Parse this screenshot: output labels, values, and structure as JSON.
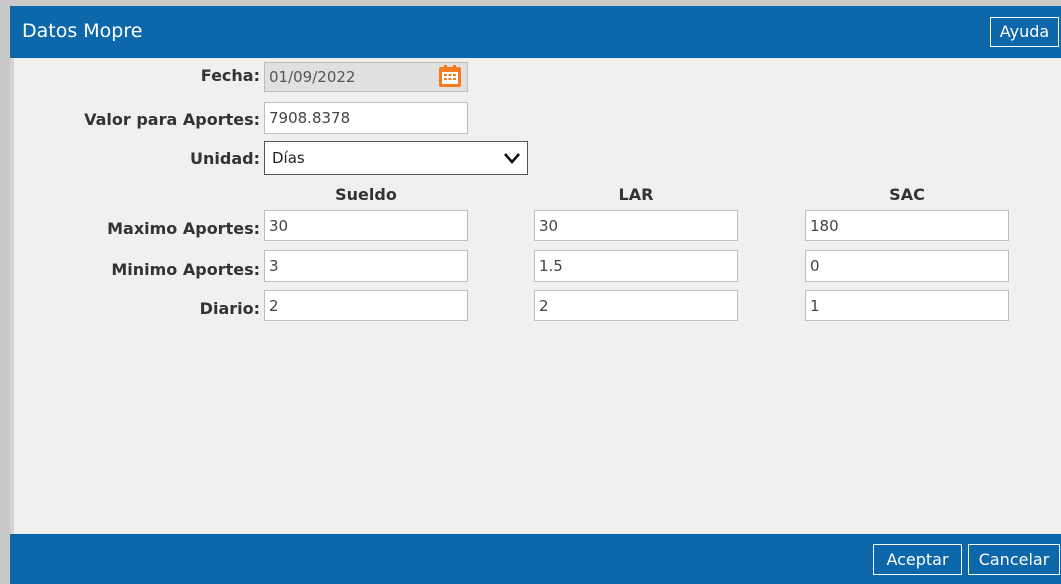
{
  "dialog": {
    "title": "Datos Mopre",
    "help_label": "Ayuda"
  },
  "form": {
    "fecha": {
      "label": "Fecha:",
      "value": "01/09/2022",
      "icon": "calendar-icon"
    },
    "valor": {
      "label": "Valor para Aportes:",
      "value": "7908.8378"
    },
    "unidad": {
      "label": "Unidad:",
      "selected": "Días"
    },
    "columns": [
      "Sueldo",
      "LAR",
      "SAC"
    ],
    "rows": [
      {
        "label": "Maximo Aportes:",
        "values": [
          "30",
          "30",
          "180"
        ]
      },
      {
        "label": "Minimo Aportes:",
        "values": [
          "3",
          "1.5",
          "0"
        ]
      },
      {
        "label": "Diario:",
        "values": [
          "2",
          "2",
          "1"
        ]
      }
    ]
  },
  "footer": {
    "accept_label": "Aceptar",
    "cancel_label": "Cancelar"
  },
  "colors": {
    "header_bg": "#0d67ab",
    "body_bg": "#f0f0f0",
    "calendar_accent": "#f47b20"
  }
}
